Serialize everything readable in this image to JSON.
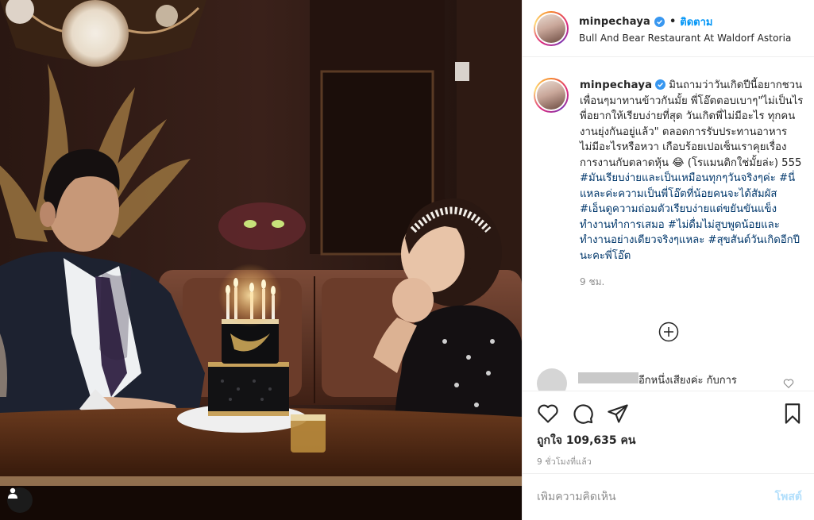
{
  "post": {
    "username": "minpechaya",
    "separator": "•",
    "follow_label": "ติดตาม",
    "location": "Bull And Bear Restaurant At Waldorf Astoria"
  },
  "caption": {
    "username": "minpechaya",
    "text": "มินถามว่าวันเกิดปีนี้อยากชวนเพื่อนๆมาทานข้าวกันมั้ย พี่โอ๊ตตอบเบาๆ\"ไม่เป็นไร พี่อยากให้เรียบง่ายที่สุด วันเกิดพี่ไม่มีอะไร ทุกคนงานยุ่งกันอยู่แล้ว\" ตลอดการรับประทานอาหารไม่มีอะไรหรือหวา เกือบร้อยเปอเซ็นเราคุยเรื่องการงานกับตลาดหุ้น 😂 (โรแมนติกใช่มั้ยล่ะ) 555 ",
    "hashtags": "#มันเรียบง่ายและเป็นเหมือนทุกๆวันจริงๆค่ะ #นี่แหละค่ะความเป็นพี่โอ๊ตที่น้อยคนจะได้สัมผัส #เอ็นดูความถ่อมตัวเรียบง่ายแต่ขยันขันแข็งทำงานทำการเสมอ #ไม่ดื่มไม่สูบพูดน้อยและทำงานอย่างเดียวจริงๆแหละ #สุขสันต์วันเกิดอีกปีนะคะพี่โอ๊ต",
    "time": "9 ชม."
  },
  "comment": {
    "text": "อีกหนึ่งเสียงค่ะ กับการ"
  },
  "actions": {
    "likes": "ถูกใจ 109,635 คน",
    "posted": "9 ชั่วโมงที่แล้ว"
  },
  "add_comment": {
    "placeholder": "เพิ่มความคิดเห็น",
    "post_label": "โพสต์"
  },
  "colors": {
    "accent": "#0095f6",
    "hashtag": "#00376b",
    "muted": "#8e8e8e",
    "border": "#efefef"
  },
  "icons": [
    "user-tag-icon",
    "verified-icon",
    "load-more-icon",
    "heart-icon",
    "comment-icon",
    "share-icon",
    "bookmark-icon"
  ]
}
